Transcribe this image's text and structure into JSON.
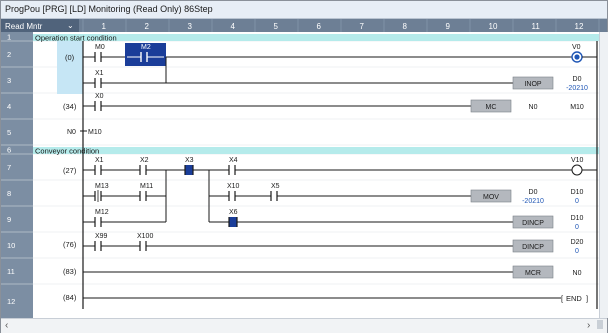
{
  "window": {
    "title": "ProgPou [PRG] [LD] Monitoring (Read Only) 86Step"
  },
  "ruler": {
    "mode_label": "Read Mntr",
    "mode_arrow": "⌄",
    "columns": [
      "1",
      "2",
      "3",
      "4",
      "5",
      "6",
      "7",
      "8",
      "9",
      "10",
      "11",
      "12"
    ]
  },
  "rows": {
    "numbers": [
      "1",
      "2",
      "3",
      "4",
      "5",
      "6",
      "7",
      "8",
      "9",
      "10",
      "11",
      "12"
    ]
  },
  "ladder": {
    "comment_operation": "Operation start condition",
    "comment_conveyor": "Conveyor condition",
    "step_0": "(0)",
    "step_34": "(34)",
    "step_27": "(27)",
    "step_76": "(76)",
    "step_83": "(83)",
    "step_84": "(84)",
    "r2_c1_label": "M0",
    "r2_c2_label": "M2",
    "r2_coil_label": "V0",
    "r3_c1_label": "X1",
    "r3_fb_name": "INOP",
    "r3_fb_val1": "D0",
    "r3_fb_val2": "-20210",
    "r4_c1_label": "X0",
    "r4_fb_name": "MC",
    "r4_fb_val1": "N0",
    "r4_fb_val2": "M10",
    "r5_mc_n": "N0",
    "r5_mc_m": "M10",
    "r7_c1_label": "X1",
    "r7_c2_label": "X2",
    "r7_c3_label": "X3",
    "r7_c4_label": "X4",
    "r7_coil_label": "V10",
    "r8_c1_label": "M13",
    "r8_c2_label": "M11",
    "r8_c3_label": "X10",
    "r8_c4_label": "X5",
    "r8_fb_name": "MOV",
    "r8_fb_src": "D0",
    "r8_fb_src_val": "-20210",
    "r8_fb_dst": "D10",
    "r8_fb_dst_val": "0",
    "r9_c1_label": "M12",
    "r9_c2_label": "X6",
    "r9_fb_name": "DINCP",
    "r9_fb_dst": "D10",
    "r9_fb_dst_val": "0",
    "r10_c1_label": "X99",
    "r10_c2_label": "X100",
    "r10_fb_name": "DINCP",
    "r10_fb_dst": "D20",
    "r10_fb_dst_val": "0",
    "r11_fb_name": "MCR",
    "r11_fb_val": "N0",
    "r12_end": "END"
  },
  "colors": {
    "rail": "#1a1a1a",
    "active_contact_fill": "#1a3d99",
    "comment_band": "#b5ebeb",
    "monitor_value": "#1f56b5",
    "fb_box": "#b4b8be"
  },
  "scroll": {
    "left_arrow": "‹",
    "right_arrow": "›"
  }
}
